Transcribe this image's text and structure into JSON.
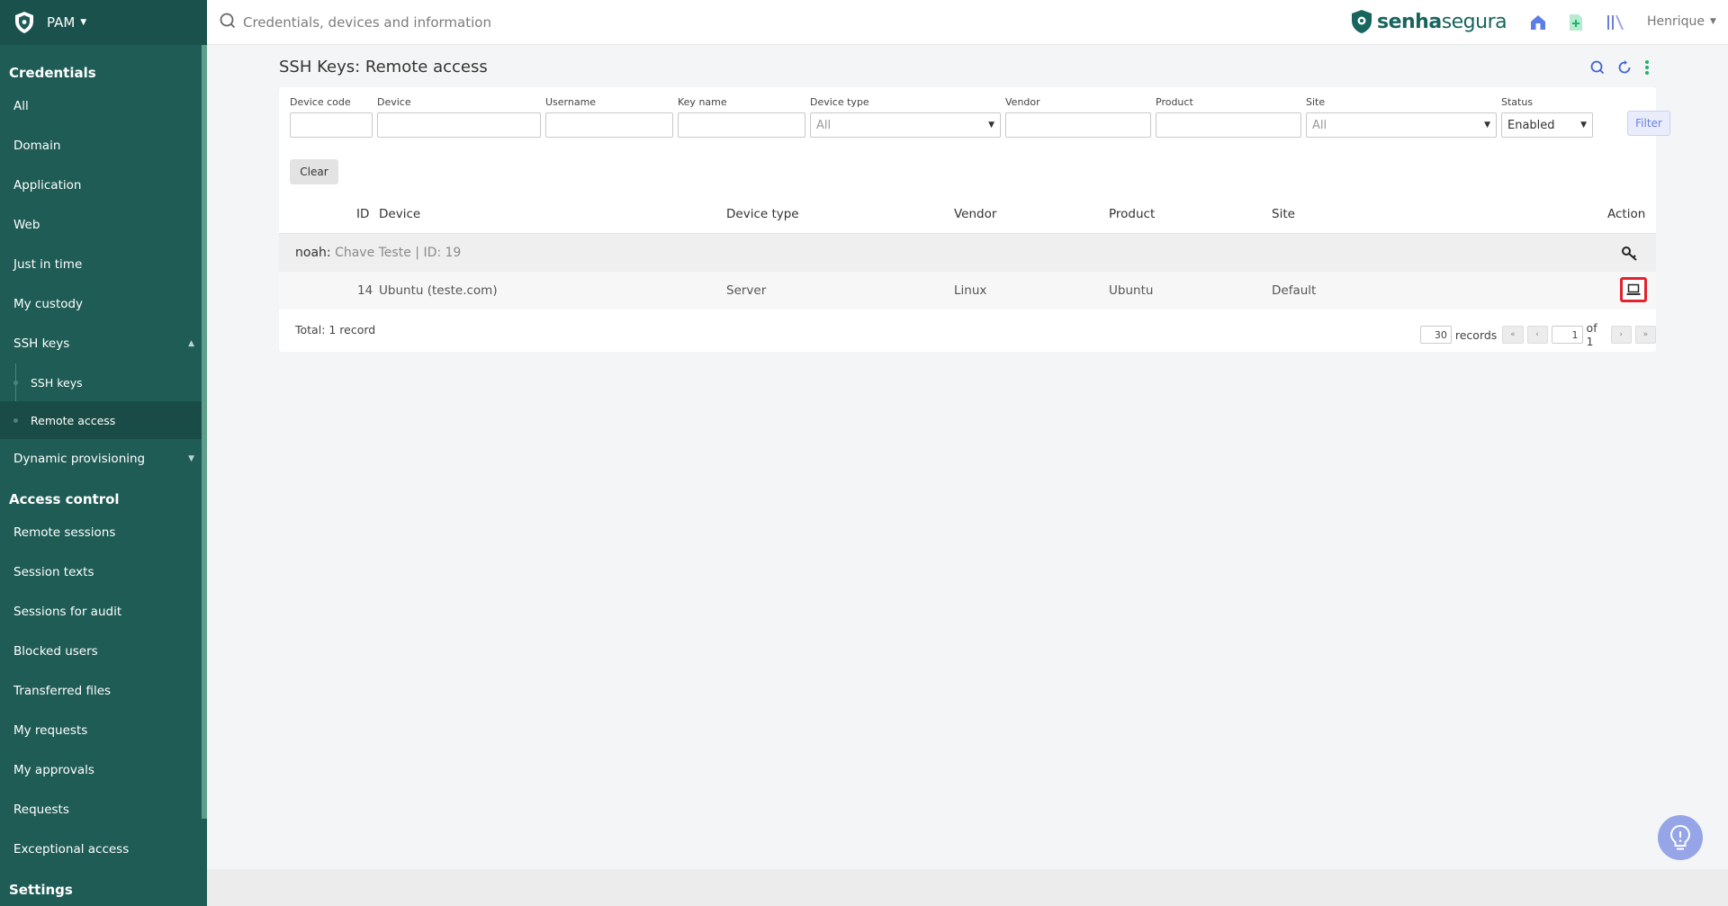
{
  "sidebar": {
    "app_label": "PAM",
    "sections": {
      "credentials": {
        "title": "Credentials",
        "items": [
          "All",
          "Domain",
          "Application",
          "Web",
          "Just in time",
          "My custody",
          "SSH keys"
        ],
        "ssh_subitems": [
          "SSH keys",
          "Remote access"
        ],
        "dynamic": "Dynamic provisioning"
      },
      "access_control": {
        "title": "Access control",
        "items": [
          "Remote sessions",
          "Session texts",
          "Sessions for audit",
          "Blocked users",
          "Transferred files",
          "My requests",
          "My approvals",
          "Requests",
          "Exceptional access"
        ]
      },
      "settings": {
        "title": "Settings"
      }
    }
  },
  "topbar": {
    "search_placeholder": "Credentials, devices and information",
    "brand_part1": "senha",
    "brand_part2": "segura",
    "user": "Henrique"
  },
  "page": {
    "title": "SSH Keys: Remote access"
  },
  "filters": {
    "device_code": {
      "label": "Device code",
      "value": ""
    },
    "device": {
      "label": "Device",
      "value": ""
    },
    "username": {
      "label": "Username",
      "value": ""
    },
    "key_name": {
      "label": "Key name",
      "value": ""
    },
    "device_type": {
      "label": "Device type",
      "value": "All"
    },
    "vendor": {
      "label": "Vendor",
      "value": ""
    },
    "product": {
      "label": "Product",
      "value": ""
    },
    "site": {
      "label": "Site",
      "value": "All"
    },
    "status": {
      "label": "Status",
      "value": "Enabled"
    },
    "filter_button": "Filter",
    "clear_button": "Clear"
  },
  "table": {
    "headers": {
      "id": "ID",
      "device": "Device",
      "device_type": "Device type",
      "vendor": "Vendor",
      "product": "Product",
      "site": "Site",
      "action": "Action"
    },
    "group": {
      "user": "noah:",
      "detail": "Chave Teste | ID: 19"
    },
    "rows": [
      {
        "id": "14",
        "device": "Ubuntu (teste.com)",
        "device_type": "Server",
        "vendor": "Linux",
        "product": "Ubuntu",
        "site": "Default"
      }
    ],
    "total": "Total: 1 record"
  },
  "pagination": {
    "per_page": "30",
    "records_label": "records",
    "page": "1",
    "of_label": "of 1",
    "first": "«",
    "prev": "‹",
    "next": "›",
    "last": "»"
  },
  "colors": {
    "sidebar": "#1f5c56",
    "brand": "#17655d",
    "accent": "#3f63d8",
    "highlight": "#e0242f"
  }
}
